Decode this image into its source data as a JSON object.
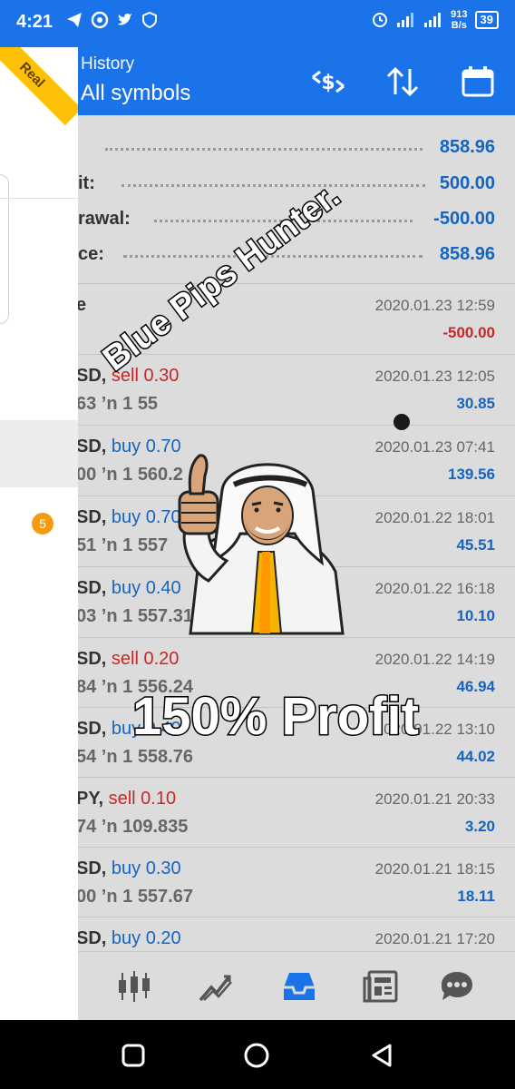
{
  "status_bar": {
    "time": "4:21",
    "speed_top": "913",
    "speed_bottom": "B/s",
    "network": "4G",
    "battery": "39"
  },
  "app_bar": {
    "subtitle": "History",
    "title": "All symbols"
  },
  "drawer": {
    "ribbon_label": "Real",
    "badge_count": "5"
  },
  "summary": [
    {
      "label": "",
      "value": "858.96"
    },
    {
      "label": "it:",
      "value": "500.00"
    },
    {
      "label": "rawal:",
      "value": "-500.00"
    },
    {
      "label": "ce:",
      "value": "858.96"
    }
  ],
  "deal": {
    "label": "e",
    "date": "2020.01.23 12:59",
    "amount": "-500.00"
  },
  "trades": [
    {
      "sym": "SD,",
      "side": "sell",
      "lot": "0.30",
      "l2": "63 ’n  1 55",
      "date": "2020.01.23 12:05",
      "profit": "30.85"
    },
    {
      "sym": "SD,",
      "side": "buy",
      "lot": "0.70",
      "l2": "00 ’n  1 560.2",
      "date": "2020.01.23 07:41",
      "profit": "139.56"
    },
    {
      "sym": "SD,",
      "side": "buy",
      "lot": "0.70",
      "l2": "51 ’n  1 557",
      "date": "2020.01.22 18:01",
      "profit": "45.51"
    },
    {
      "sym": "SD,",
      "side": "buy",
      "lot": "0.40",
      "l2": "03 ’n  1 557.31",
      "date": "2020.01.22 16:18",
      "profit": "10.10"
    },
    {
      "sym": "SD,",
      "side": "sell",
      "lot": "0.20",
      "l2": "84 ’n  1 556.24",
      "date": "2020.01.22 14:19",
      "profit": "46.94"
    },
    {
      "sym": "SD,",
      "side": "buy",
      "lot": "0.40",
      "l2": "54 ’n  1 558.76",
      "date": "2020.01.22 13:10",
      "profit": "44.02"
    },
    {
      "sym": "PY,",
      "side": "sell",
      "lot": "0.10",
      "l2": "74 ’n  109.835",
      "date": "2020.01.21 20:33",
      "profit": "3.20"
    },
    {
      "sym": "SD,",
      "side": "buy",
      "lot": "0.30",
      "l2": "00 ’n  1 557.67",
      "date": "2020.01.21 18:15",
      "profit": "18.11"
    },
    {
      "sym": "SD,",
      "side": "buy",
      "lot": "0.20",
      "l2": "",
      "date": "2020.01.21 17:20",
      "profit": ""
    }
  ],
  "overlay": {
    "watermark": "Blue Pips Hunter.",
    "profit_caption": "150% Profit"
  },
  "colors": {
    "accent": "#1a73e8",
    "buy": "#1565c0",
    "sell": "#c62828",
    "ribbon": "#ffc107",
    "badge": "#f39c12"
  },
  "icons": {
    "app_bar": [
      "currency-exchange-icon",
      "sort-icon",
      "calendar-icon"
    ],
    "bottom_nav": [
      "quotes-icon",
      "chart-icon",
      "history-icon",
      "news-icon",
      "chat-icon"
    ]
  }
}
